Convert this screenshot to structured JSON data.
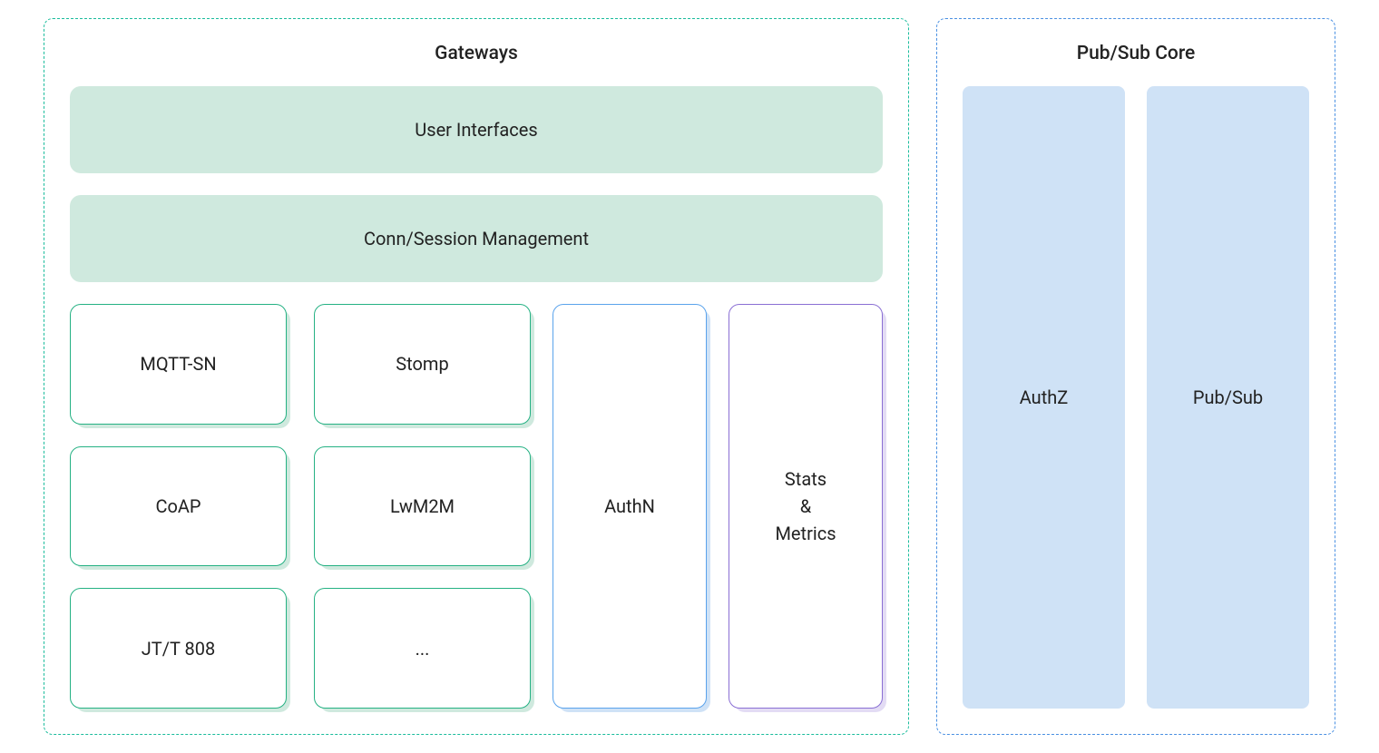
{
  "gateways": {
    "title": "Gateways",
    "user_interfaces": "User Interfaces",
    "conn_session": "Conn/Session Management",
    "protocols": {
      "mqtt_sn": "MQTT-SN",
      "stomp": "Stomp",
      "coap": "CoAP",
      "lwm2m": "LwM2M",
      "jtt808": "JT/T 808",
      "more": "..."
    },
    "authn": "AuthN",
    "stats_metrics": "Stats\n&\nMetrics"
  },
  "pubsub_core": {
    "title": "Pub/Sub Core",
    "authz": "AuthZ",
    "pubsub": "Pub/Sub"
  }
}
